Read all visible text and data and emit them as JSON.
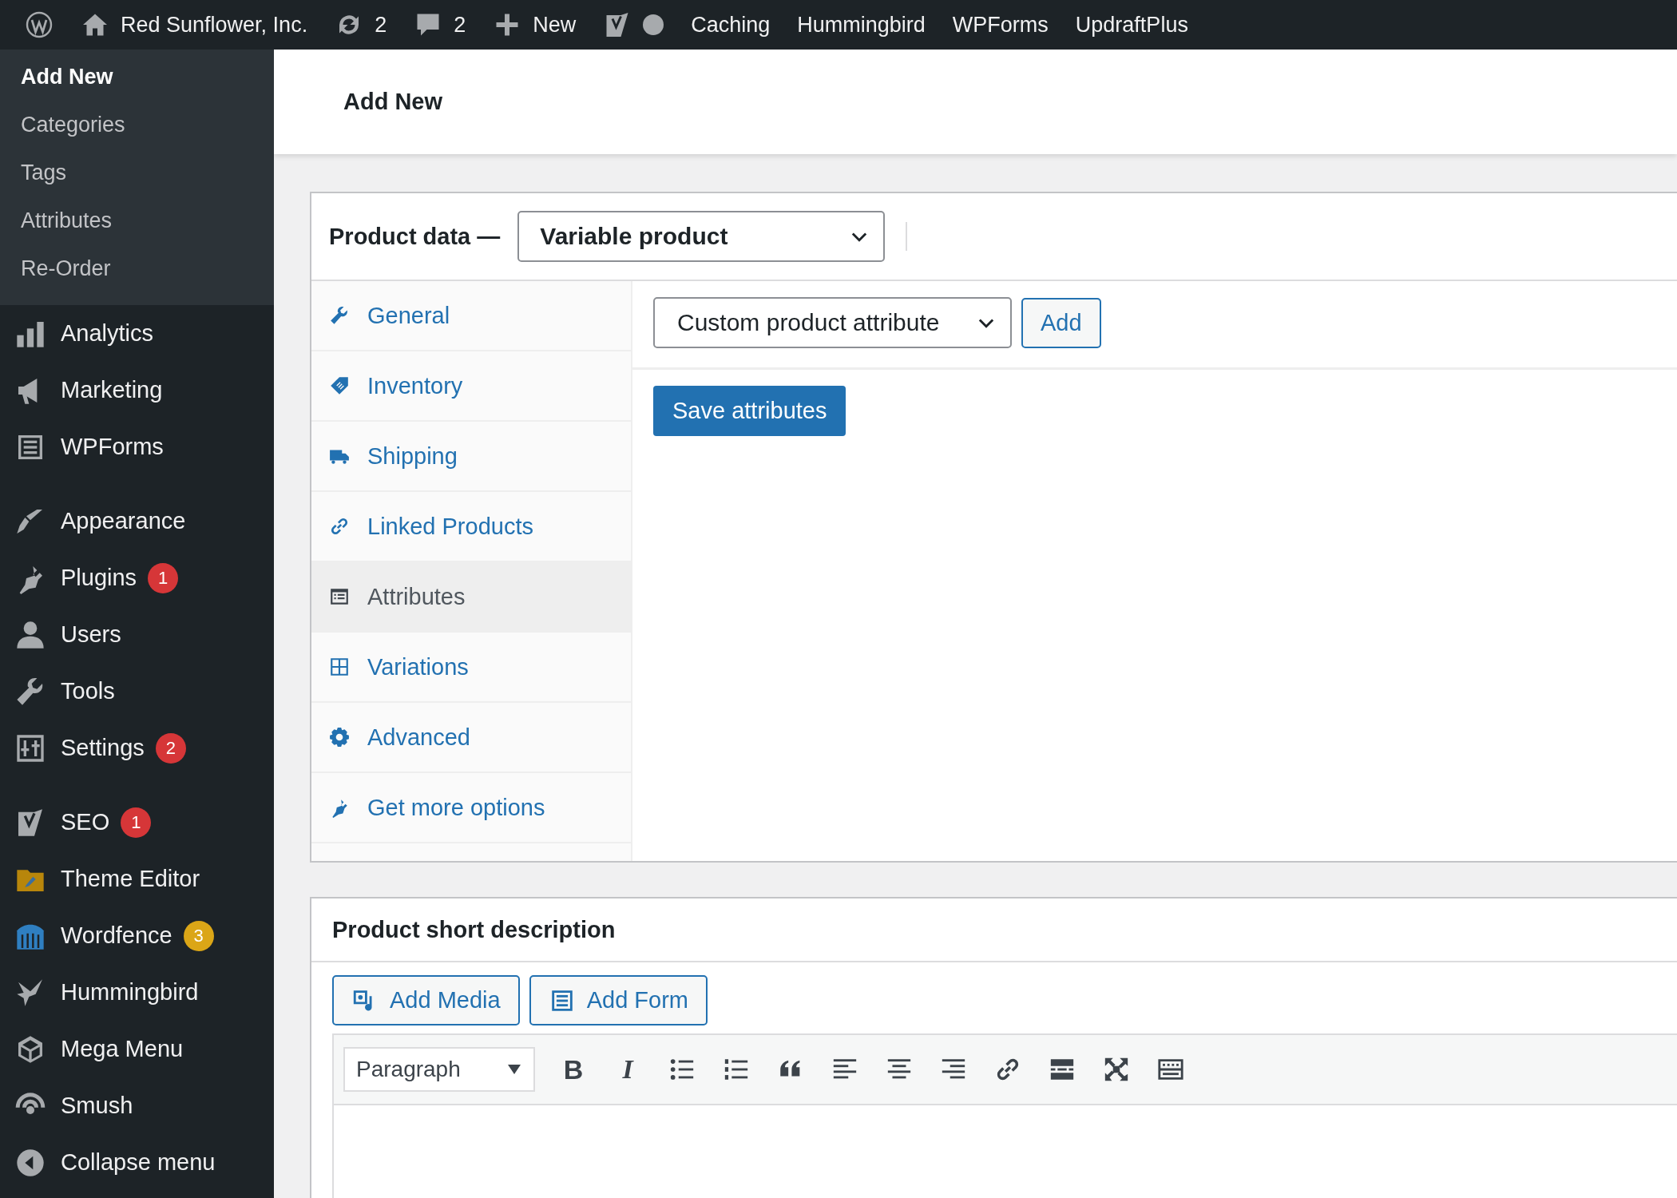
{
  "admin_bar": {
    "site_name": "Red Sunflower, Inc.",
    "updates_count": "2",
    "comments_count": "2",
    "new_label": "New",
    "links": [
      "Caching",
      "Hummingbird",
      "WPForms",
      "UpdraftPlus"
    ]
  },
  "sidebar": {
    "submenu": [
      {
        "label": "Add New",
        "selected": true
      },
      {
        "label": "Categories",
        "selected": false
      },
      {
        "label": "Tags",
        "selected": false
      },
      {
        "label": "Attributes",
        "selected": false
      },
      {
        "label": "Re-Order",
        "selected": false
      }
    ],
    "groups": [
      [
        {
          "label": "Analytics"
        },
        {
          "label": "Marketing"
        },
        {
          "label": "WPForms"
        }
      ],
      [
        {
          "label": "Appearance"
        },
        {
          "label": "Plugins",
          "badge": {
            "text": "1",
            "color": "#d63638"
          }
        },
        {
          "label": "Users"
        },
        {
          "label": "Tools"
        },
        {
          "label": "Settings",
          "badge": {
            "text": "2",
            "color": "#d63638"
          }
        }
      ],
      [
        {
          "label": "SEO",
          "badge": {
            "text": "1",
            "color": "#d63638"
          }
        },
        {
          "label": "Theme Editor"
        },
        {
          "label": "Wordfence",
          "badge": {
            "text": "3",
            "color": "#dba617"
          }
        },
        {
          "label": "Hummingbird"
        },
        {
          "label": "Mega Menu"
        },
        {
          "label": "Smush"
        },
        {
          "label": "Collapse menu"
        }
      ]
    ]
  },
  "page_title": "Add New",
  "product_data": {
    "label": "Product data —",
    "type_value": "Variable product",
    "tabs": [
      {
        "label": "General",
        "selected": false
      },
      {
        "label": "Inventory",
        "selected": false
      },
      {
        "label": "Shipping",
        "selected": false
      },
      {
        "label": "Linked Products",
        "selected": false
      },
      {
        "label": "Attributes",
        "selected": true
      },
      {
        "label": "Variations",
        "selected": false
      },
      {
        "label": "Advanced",
        "selected": false
      },
      {
        "label": "Get more options",
        "selected": false
      }
    ],
    "attribute_select": "Custom product attribute",
    "add_button": "Add",
    "save_button": "Save attributes"
  },
  "short_description": {
    "title": "Product short description",
    "media_buttons": [
      "Add Media",
      "Add Form"
    ],
    "format_select": "Paragraph",
    "toolbar": [
      {
        "kind": "bold",
        "label": "B"
      },
      {
        "kind": "italic",
        "label": "I"
      },
      {
        "kind": "bullets"
      },
      {
        "kind": "numbers"
      },
      {
        "kind": "quote"
      },
      {
        "kind": "left"
      },
      {
        "kind": "center"
      },
      {
        "kind": "right"
      },
      {
        "kind": "link"
      },
      {
        "kind": "more"
      },
      {
        "kind": "fullscreen"
      },
      {
        "kind": "kitchen"
      }
    ]
  }
}
